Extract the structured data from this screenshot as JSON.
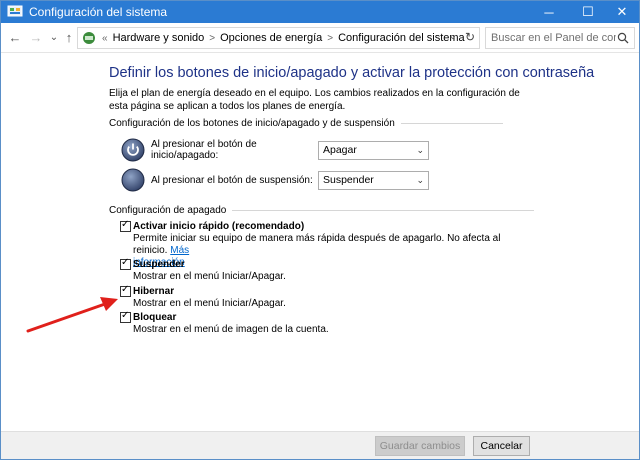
{
  "window": {
    "title": "Configuración del sistema"
  },
  "window_controls": {
    "minimize": "─",
    "maximize": "☐",
    "close": "✕"
  },
  "nav": {
    "back": "←",
    "forward": "→",
    "dropdown": "⌄",
    "up": "↑",
    "overflow": "«",
    "breadcrumbs": [
      "Hardware y sonido",
      "Opciones de energía",
      "Configuración del sistema"
    ],
    "separator": ">",
    "search_placeholder": "Buscar en el Panel de control"
  },
  "page": {
    "title": "Definir los botones de inicio/apagado y activar la protección con contraseña",
    "description": "Elija el plan de energía deseado en el equipo. Los cambios realizados en la configuración de esta página se aplican a todos los planes de energía."
  },
  "buttons_section": {
    "heading": "Configuración de los botones de inicio/apagado y de suspensión",
    "power_button_label": "Al presionar el botón de inicio/apagado:",
    "power_button_value": "Apagar",
    "sleep_button_label": "Al presionar el botón de suspensión:",
    "sleep_button_value": "Suspender"
  },
  "shutdown_section": {
    "heading": "Configuración de apagado",
    "items": [
      {
        "label": "Activar inicio rápido (recomendado)",
        "checked": true,
        "desc": "Permite iniciar su equipo de manera más rápida después de apagarlo. No afecta al reinicio.",
        "link1": "Más",
        "link2": "información"
      },
      {
        "label": "Suspender",
        "checked": true,
        "desc": "Mostrar en el menú Iniciar/Apagar."
      },
      {
        "label": "Hibernar",
        "checked": true,
        "desc": "Mostrar en el menú Iniciar/Apagar."
      },
      {
        "label": "Bloquear",
        "checked": true,
        "desc": "Mostrar en el menú de imagen de la cuenta."
      }
    ]
  },
  "footer": {
    "save": "Guardar cambios",
    "cancel": "Cancelar"
  },
  "colors": {
    "titlebar": "#2b7bd3",
    "heading": "#1e3287",
    "link": "#0066cc",
    "arrow": "#e0201b"
  },
  "icons": {
    "app": "control-panel-icon",
    "power": "power-button-icon",
    "sleep": "sleep-moon-icon",
    "search": "search-icon"
  }
}
